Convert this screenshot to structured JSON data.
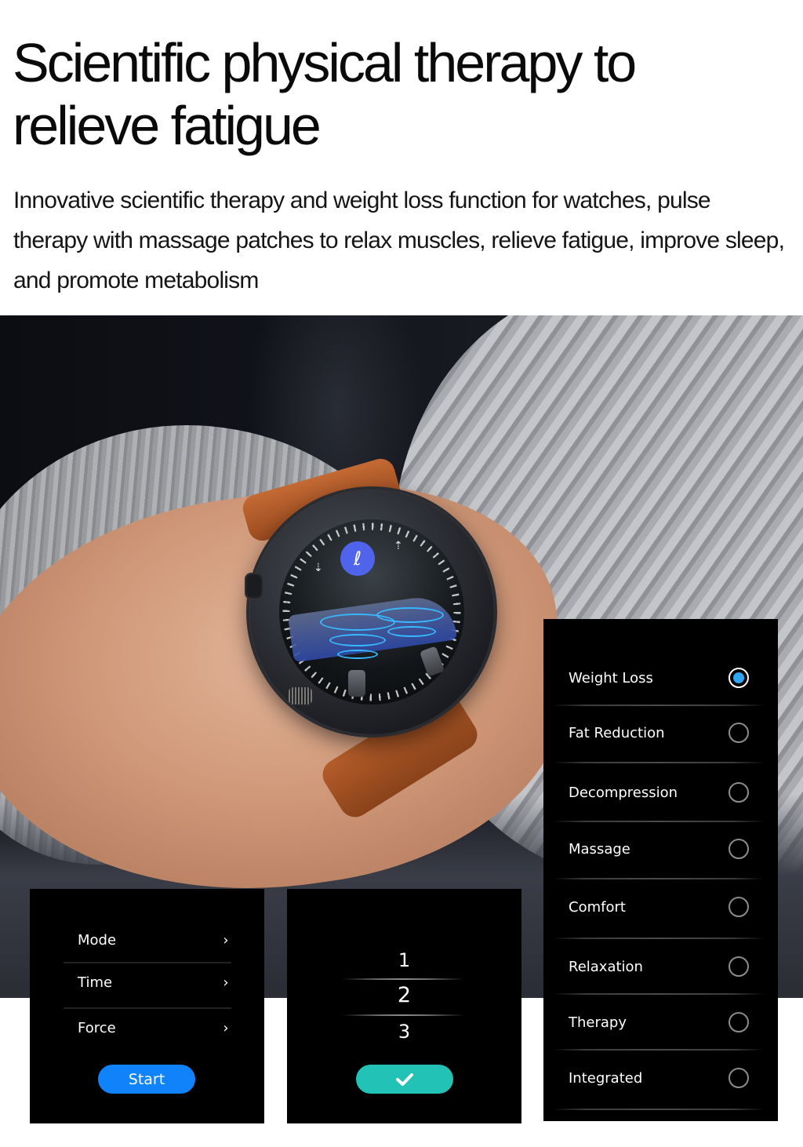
{
  "header": {
    "title": "Scientific physical therapy to relieve fatigue",
    "description": "Innovative scientific therapy and weight loss function for watches, pulse therapy with massage patches to relax muscles, relieve fatigue, improve sleep, and promote metabolism"
  },
  "watch_face": {
    "mode_icon_glyph": "ℓ",
    "left_icon_glyph": "⇣",
    "right_icon_glyph": "⇡"
  },
  "settings_panel": {
    "rows": [
      {
        "label": "Mode",
        "chevron": "›"
      },
      {
        "label": "Time",
        "chevron": "›"
      },
      {
        "label": "Force",
        "chevron": "›"
      }
    ],
    "start_label": "Start",
    "start_color": "#1082fa"
  },
  "picker_panel": {
    "values": [
      "1",
      "2",
      "3"
    ],
    "confirm_icon": "check-icon",
    "confirm_color": "#22c2b6"
  },
  "modes_panel": {
    "selected": "Weight Loss",
    "accent_color": "#2ea6f5",
    "options": [
      {
        "label": "Weight Loss",
        "selected": true
      },
      {
        "label": "Fat Reduction",
        "selected": false
      },
      {
        "label": "Decompression",
        "selected": false
      },
      {
        "label": "Massage",
        "selected": false
      },
      {
        "label": "Comfort",
        "selected": false
      },
      {
        "label": "Relaxation",
        "selected": false
      },
      {
        "label": "Therapy",
        "selected": false
      },
      {
        "label": "Integrated",
        "selected": false
      }
    ]
  }
}
